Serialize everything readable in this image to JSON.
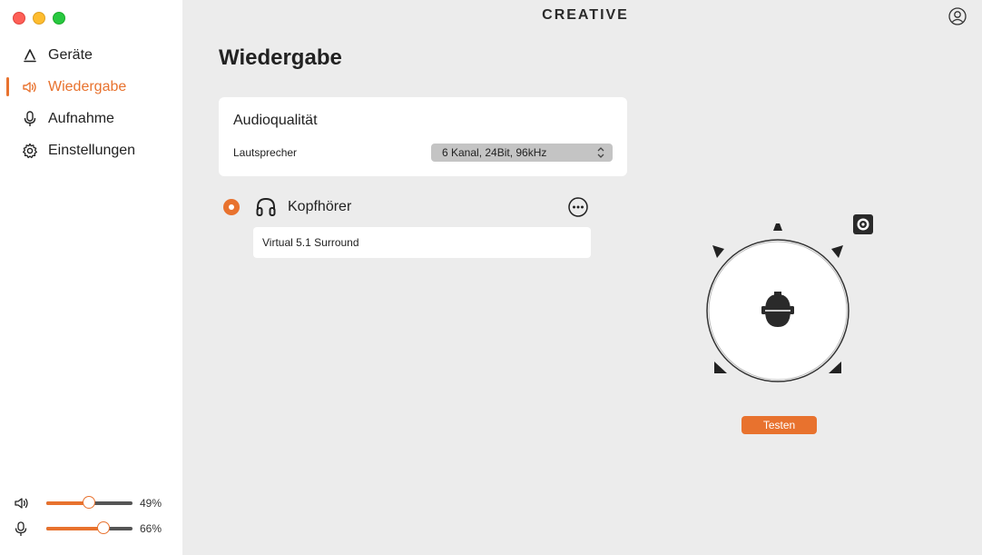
{
  "sidebar": {
    "items": [
      {
        "label": "Geräte",
        "icon": "devices-icon",
        "active": false
      },
      {
        "label": "Wiedergabe",
        "icon": "speaker-icon",
        "active": true
      },
      {
        "label": "Aufnahme",
        "icon": "microphone-icon",
        "active": false
      },
      {
        "label": "Einstellungen",
        "icon": "gear-icon",
        "active": false
      }
    ],
    "volume": {
      "icon": "speaker-icon",
      "value": 49,
      "label": "49%"
    },
    "mic": {
      "icon": "microphone-icon",
      "value": 66,
      "label": "66%"
    }
  },
  "header": {
    "brand": "CREATIVE",
    "profile_icon": "user-circle-icon"
  },
  "main": {
    "title": "Wiedergabe",
    "audio_quality": {
      "title": "Audioqualität",
      "speaker_label": "Lautsprecher",
      "speaker_value": "6 Kanal, 24Bit, 96kHz"
    },
    "device": {
      "name": "Kopfhörer",
      "selected": true,
      "icon": "headphones-icon",
      "mode": "Virtual 5.1 Surround"
    },
    "test_button": "Testen"
  },
  "colors": {
    "accent": "#e8722e",
    "sidebar_bg": "#ffffff",
    "main_bg": "#ececec"
  }
}
